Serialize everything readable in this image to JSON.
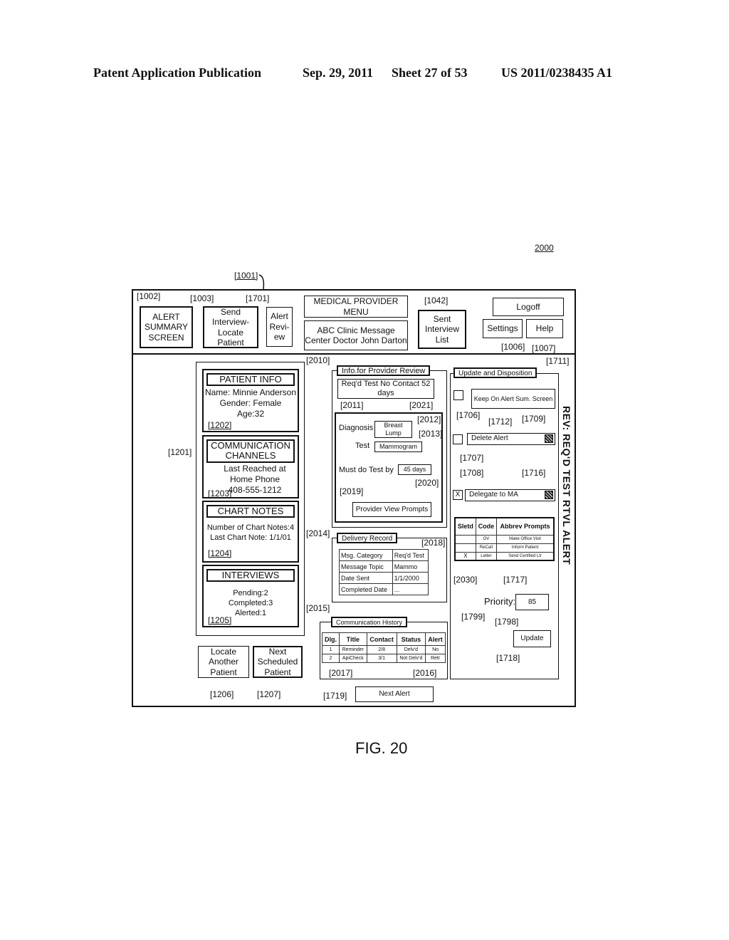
{
  "page_header": {
    "publication": "Patent Application Publication",
    "date": "Sep. 29, 2011",
    "sheet": "Sheet 27 of 53",
    "patent_number": "US 2011/0238435 A1"
  },
  "figure_ref": "2000",
  "figure_caption": "FIG. 20",
  "screen_ref": "[1001]",
  "toolbar": {
    "alert_summary": {
      "label": "ALERT SUMMARY SCREEN",
      "ref": "[1002]"
    },
    "send_interview": {
      "label": "Send Interview-Locate Patient",
      "ref": "[1003]"
    },
    "alert_review": {
      "label": "Alert Revi-ew",
      "ref": "[1701]"
    },
    "menu_title": "MEDICAL PROVIDER MENU",
    "clinic_info": "ABC Clinic Message Center Doctor John Darton",
    "sent_interview_list": {
      "label": "Sent Interview List",
      "ref": "[1042]"
    },
    "logoff": "Logoff",
    "settings": {
      "label": "Settings",
      "ref": "[1006]"
    },
    "help": {
      "label": "Help",
      "ref": "[1007]"
    }
  },
  "patient_panel": {
    "ref": "[1201]",
    "patient_info": {
      "title": "PATIENT INFO",
      "name": "Name: Minnie Anderson",
      "gender": "Gender: Female",
      "age": "Age:32",
      "ref": "[1202]"
    },
    "communication": {
      "title": "COMMUNICATION CHANNELS",
      "line1": "Last Reached at",
      "line2": "Home Phone",
      "phone": "408-555-1212",
      "ref": "[1203]"
    },
    "chart_notes": {
      "title": "CHART NOTES",
      "count": "Number of Chart Notes:4",
      "last": "Last Chart Note: 1/1/01",
      "ref": "[1204]"
    },
    "interviews": {
      "title": "INTERVIEWS",
      "pending": "Pending:2",
      "completed": "Completed:3",
      "alerted": "Alerted:1",
      "ref": "[1205]"
    }
  },
  "bottom_buttons": {
    "locate_another": {
      "label": "Locate Another Patient",
      "ref": "[1206]"
    },
    "next_scheduled": {
      "label": "Next Scheduled Patient",
      "ref": "[1207]"
    },
    "next_alert": {
      "label": "Next Alert",
      "ref": "[1719]"
    }
  },
  "provider_review": {
    "ref": "[2010]",
    "title": "Info.for Provider Review",
    "no_contact": {
      "label": "Req'd Test No Contact 52 days",
      "ref": "[2021]"
    },
    "details_ref": "[2011]",
    "diagnosis_label": "Diagnosis",
    "diagnosis_value": {
      "value": "Breast Lump",
      "ref": "[2012]"
    },
    "test_label": "Test",
    "test_value": {
      "value": "Mammogram",
      "ref": "[2013]"
    },
    "must_do_label": "Must do Test by",
    "must_do_value": {
      "value": "45 days",
      "ref": "[2020]"
    },
    "prompts_button": {
      "label": "Provider View Prompts",
      "ref": "[2019]"
    }
  },
  "delivery_record": {
    "ref": "[2014]",
    "title": "Delivery Record",
    "table_ref": "[2018]",
    "rows": [
      {
        "label": "Msg. Category",
        "value": "Req'd Test"
      },
      {
        "label": "Message Topic",
        "value": "Mammo"
      },
      {
        "label": "Date Sent",
        "value": "1/1/2000"
      },
      {
        "label": "Completed Date",
        "value": "..."
      }
    ]
  },
  "communication_history": {
    "ref": "[2015]",
    "title": "Communication History",
    "columns": [
      "Dlg.",
      "Title",
      "Contact",
      "Status",
      "Alert"
    ],
    "rows": [
      [
        "1",
        "Reminder",
        "2/8",
        "Delv'd",
        "No"
      ],
      [
        "2",
        "ApiCheck",
        "3/1",
        "Not Delv'd",
        "Retr"
      ]
    ],
    "row_ref": "[2017]",
    "status_ref": "[2016]"
  },
  "disposition": {
    "ref": "[1711]",
    "title": "Update and Disposition",
    "keep_on_alert": {
      "label": "Keep On Alert Sum. Screen",
      "checkbox_ref": "[1706]",
      "ref": "[1712]",
      "checked": false
    },
    "delete_alert": {
      "value": "Delete Alert",
      "checkbox_ref": "[1707]",
      "ref": "[1709]",
      "checked": false
    },
    "delegate": {
      "value": "Delegate to MA",
      "checkbox_ref": "[1708]",
      "ref": "[1716]",
      "checked": true,
      "mark": "X"
    },
    "prompts_table": {
      "columns": [
        "Sletd",
        "Code",
        "Abbrev Prompts"
      ],
      "rows": [
        [
          "",
          "OV",
          "Make Office Visit"
        ],
        [
          "",
          "ReCall",
          "Inform Patient"
        ],
        [
          "X",
          "Letter",
          "Send Certified Ltr"
        ]
      ],
      "sel_ref": "[2030]",
      "ref": "[1717]"
    },
    "priority": {
      "label": "Priority:",
      "value": "85",
      "label_ref": "[1799]",
      "ref": "[1798]"
    },
    "update": {
      "label": "Update",
      "ref": "[1718]"
    }
  },
  "vertical_title": "REV: REQ'D TEST RTVL ALERT"
}
